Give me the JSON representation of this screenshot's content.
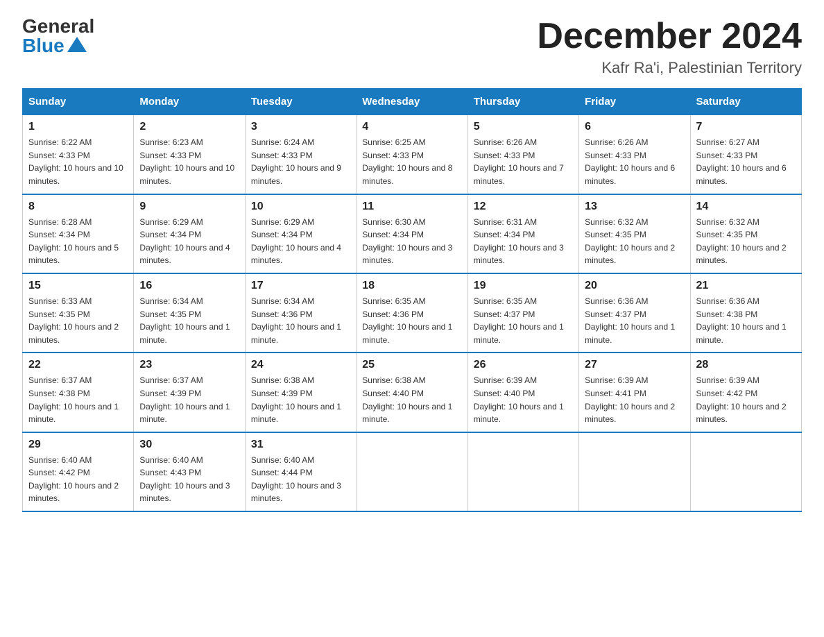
{
  "logo": {
    "general": "General",
    "blue": "Blue"
  },
  "title": "December 2024",
  "location": "Kafr Ra'i, Palestinian Territory",
  "headers": [
    "Sunday",
    "Monday",
    "Tuesday",
    "Wednesday",
    "Thursday",
    "Friday",
    "Saturday"
  ],
  "weeks": [
    [
      {
        "day": "1",
        "sunrise": "6:22 AM",
        "sunset": "4:33 PM",
        "daylight": "10 hours and 10 minutes."
      },
      {
        "day": "2",
        "sunrise": "6:23 AM",
        "sunset": "4:33 PM",
        "daylight": "10 hours and 10 minutes."
      },
      {
        "day": "3",
        "sunrise": "6:24 AM",
        "sunset": "4:33 PM",
        "daylight": "10 hours and 9 minutes."
      },
      {
        "day": "4",
        "sunrise": "6:25 AM",
        "sunset": "4:33 PM",
        "daylight": "10 hours and 8 minutes."
      },
      {
        "day": "5",
        "sunrise": "6:26 AM",
        "sunset": "4:33 PM",
        "daylight": "10 hours and 7 minutes."
      },
      {
        "day": "6",
        "sunrise": "6:26 AM",
        "sunset": "4:33 PM",
        "daylight": "10 hours and 6 minutes."
      },
      {
        "day": "7",
        "sunrise": "6:27 AM",
        "sunset": "4:33 PM",
        "daylight": "10 hours and 6 minutes."
      }
    ],
    [
      {
        "day": "8",
        "sunrise": "6:28 AM",
        "sunset": "4:34 PM",
        "daylight": "10 hours and 5 minutes."
      },
      {
        "day": "9",
        "sunrise": "6:29 AM",
        "sunset": "4:34 PM",
        "daylight": "10 hours and 4 minutes."
      },
      {
        "day": "10",
        "sunrise": "6:29 AM",
        "sunset": "4:34 PM",
        "daylight": "10 hours and 4 minutes."
      },
      {
        "day": "11",
        "sunrise": "6:30 AM",
        "sunset": "4:34 PM",
        "daylight": "10 hours and 3 minutes."
      },
      {
        "day": "12",
        "sunrise": "6:31 AM",
        "sunset": "4:34 PM",
        "daylight": "10 hours and 3 minutes."
      },
      {
        "day": "13",
        "sunrise": "6:32 AM",
        "sunset": "4:35 PM",
        "daylight": "10 hours and 2 minutes."
      },
      {
        "day": "14",
        "sunrise": "6:32 AM",
        "sunset": "4:35 PM",
        "daylight": "10 hours and 2 minutes."
      }
    ],
    [
      {
        "day": "15",
        "sunrise": "6:33 AM",
        "sunset": "4:35 PM",
        "daylight": "10 hours and 2 minutes."
      },
      {
        "day": "16",
        "sunrise": "6:34 AM",
        "sunset": "4:35 PM",
        "daylight": "10 hours and 1 minute."
      },
      {
        "day": "17",
        "sunrise": "6:34 AM",
        "sunset": "4:36 PM",
        "daylight": "10 hours and 1 minute."
      },
      {
        "day": "18",
        "sunrise": "6:35 AM",
        "sunset": "4:36 PM",
        "daylight": "10 hours and 1 minute."
      },
      {
        "day": "19",
        "sunrise": "6:35 AM",
        "sunset": "4:37 PM",
        "daylight": "10 hours and 1 minute."
      },
      {
        "day": "20",
        "sunrise": "6:36 AM",
        "sunset": "4:37 PM",
        "daylight": "10 hours and 1 minute."
      },
      {
        "day": "21",
        "sunrise": "6:36 AM",
        "sunset": "4:38 PM",
        "daylight": "10 hours and 1 minute."
      }
    ],
    [
      {
        "day": "22",
        "sunrise": "6:37 AM",
        "sunset": "4:38 PM",
        "daylight": "10 hours and 1 minute."
      },
      {
        "day": "23",
        "sunrise": "6:37 AM",
        "sunset": "4:39 PM",
        "daylight": "10 hours and 1 minute."
      },
      {
        "day": "24",
        "sunrise": "6:38 AM",
        "sunset": "4:39 PM",
        "daylight": "10 hours and 1 minute."
      },
      {
        "day": "25",
        "sunrise": "6:38 AM",
        "sunset": "4:40 PM",
        "daylight": "10 hours and 1 minute."
      },
      {
        "day": "26",
        "sunrise": "6:39 AM",
        "sunset": "4:40 PM",
        "daylight": "10 hours and 1 minute."
      },
      {
        "day": "27",
        "sunrise": "6:39 AM",
        "sunset": "4:41 PM",
        "daylight": "10 hours and 2 minutes."
      },
      {
        "day": "28",
        "sunrise": "6:39 AM",
        "sunset": "4:42 PM",
        "daylight": "10 hours and 2 minutes."
      }
    ],
    [
      {
        "day": "29",
        "sunrise": "6:40 AM",
        "sunset": "4:42 PM",
        "daylight": "10 hours and 2 minutes."
      },
      {
        "day": "30",
        "sunrise": "6:40 AM",
        "sunset": "4:43 PM",
        "daylight": "10 hours and 3 minutes."
      },
      {
        "day": "31",
        "sunrise": "6:40 AM",
        "sunset": "4:44 PM",
        "daylight": "10 hours and 3 minutes."
      },
      null,
      null,
      null,
      null
    ]
  ]
}
